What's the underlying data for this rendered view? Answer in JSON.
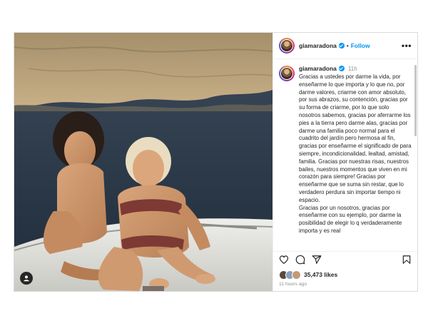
{
  "post": {
    "username": "giamaradona",
    "follow_label": "Follow",
    "more_label": "•••",
    "caption_time": "11h",
    "caption": "Gracias a ustedes por darme la vida, por enseñarme lo que importa y lo que no, por darme valores, criarme con amor absoluto, por sus abrazos, su contención, gracias por su forma de criarme, por lo que solo nosotros sabemos, gracias por aferrarme los pies a la tierra pero darme alas, gracias por darme una familia poco normal para el cuadrito del jardín pero hermosa al fin, gracias por enseñarme el significado de para siempre, incondicionalidad, lealtad, amistad, familia. Gracias por nuestras risas, nuestros bailes, nuestros momentos que viven en mi corazón para siempre! Gracias por enseñarme que se suma sin restar, que lo verdadero perdura sin importar tiempo ni espacio.\nGracias por un nosotros, gracias por enseñarme con su ejemplo, por darme la posibilidad de elegir lo q verdaderamente importa y es real",
    "likes": "35,473 likes",
    "time_ago": "11 hours ago"
  },
  "icons": {
    "like": "heart-icon",
    "comment": "comment-icon",
    "share": "share-icon",
    "save": "bookmark-icon",
    "tagged": "person-icon",
    "verified": "verified-badge-icon"
  },
  "colors": {
    "accent": "#0095f6",
    "text": "#262626",
    "muted": "#8e8e8e",
    "border": "#dbdbdb"
  }
}
